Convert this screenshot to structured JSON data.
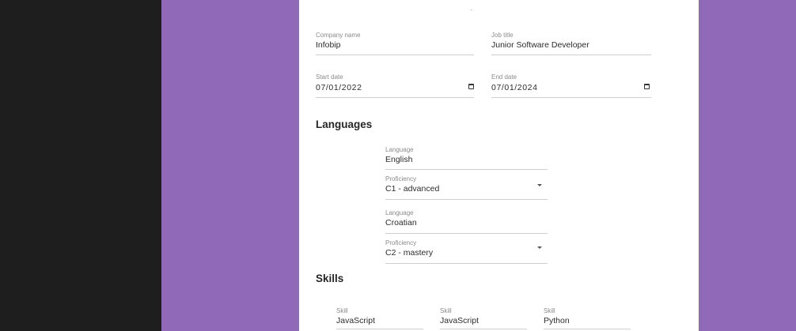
{
  "experience": {
    "company_label": "Company name",
    "company_value": "Infobip",
    "job_label": "Job title",
    "job_value": "Junior Software Developer",
    "start_label": "Start date",
    "start_value": "07/01/2022",
    "end_label": "End date",
    "end_value": "07/01/2024"
  },
  "languages": {
    "title": "Languages",
    "items": [
      {
        "language_label": "Language",
        "language_value": "English",
        "proficiency_label": "Proficiency",
        "proficiency_value": "C1 - advanced"
      },
      {
        "language_label": "Language",
        "language_value": "Croatian",
        "proficiency_label": "Proficiency",
        "proficiency_value": "C2 - mastery"
      }
    ]
  },
  "skills": {
    "title": "Skills",
    "items": [
      {
        "label": "Skill",
        "value": "JavaScript"
      },
      {
        "label": "Skill",
        "value": "JavaScript"
      },
      {
        "label": "Skill",
        "value": "Python"
      }
    ]
  },
  "icons": {
    "calendar": "calendar-icon",
    "dropdown": "dropdown-caret-icon"
  },
  "colors": {
    "background_purple": "#9069b9",
    "background_dark": "#1e1e1e",
    "card": "#ffffff"
  }
}
